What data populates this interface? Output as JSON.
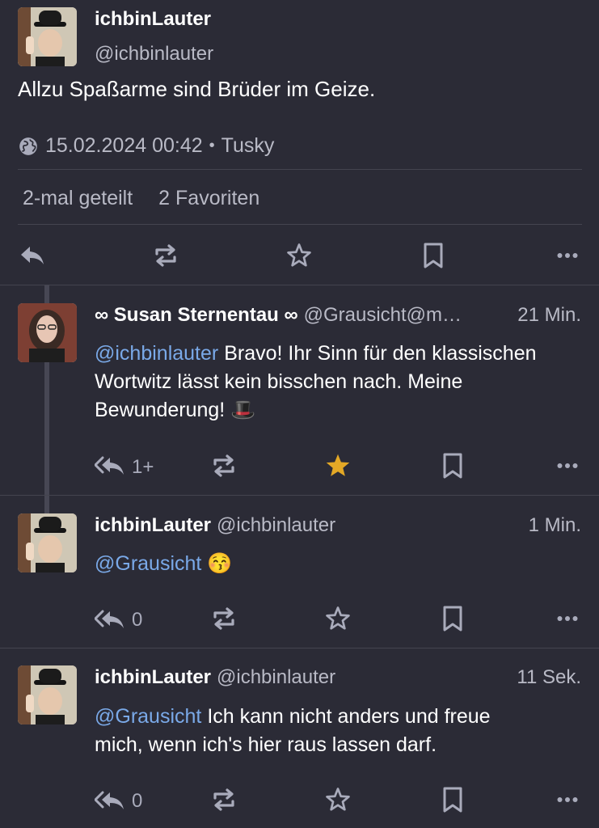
{
  "main_status": {
    "display_name": "ichbinLauter",
    "handle": "@ichbinlauter",
    "text": "Allzu Spaßarme sind Brüder im Geize.",
    "timestamp": "15.02.2024 00:42",
    "separator": "•",
    "client": "Tusky",
    "boosts": "2-mal geteilt",
    "favourites": "2 Favoriten"
  },
  "replies": [
    {
      "display_name": "∞ Susan Sternentau ∞",
      "handle": "@Grausicht@m…",
      "time": "21 Min.",
      "mention": "@ichbinlauter",
      "text_line1": " Bravo! Ihr Sinn für den klassischen",
      "text_line2": "Wortwitz lässt kein bisschen nach. Meine",
      "text_line3": "Bewunderung! 🎩",
      "reply_count": "1+",
      "favourited": true
    },
    {
      "display_name": "ichbinLauter",
      "handle": "@ichbinlauter",
      "time": "1 Min.",
      "mention": "@Grausicht",
      "text_line1": " 😚",
      "reply_count": "0",
      "favourited": false
    },
    {
      "display_name": "ichbinLauter",
      "handle": "@ichbinlauter",
      "time": "11 Sek.",
      "mention": "@Grausicht",
      "text_line1": " Ich kann nicht anders und freue",
      "text_line2": "mich, wenn ich's hier raus lassen darf.",
      "reply_count": "0",
      "favourited": false
    }
  ],
  "icons": {
    "reply": "reply-icon",
    "reply_all": "reply-all-icon",
    "boost": "boost-icon",
    "favourite": "star-icon",
    "bookmark": "bookmark-icon",
    "more": "more-icon",
    "globe": "globe-icon"
  },
  "colors": {
    "background": "#2b2b36",
    "mention": "#7aa9e8",
    "favourite_active": "#e3a826",
    "icon": "#a9abbb"
  }
}
